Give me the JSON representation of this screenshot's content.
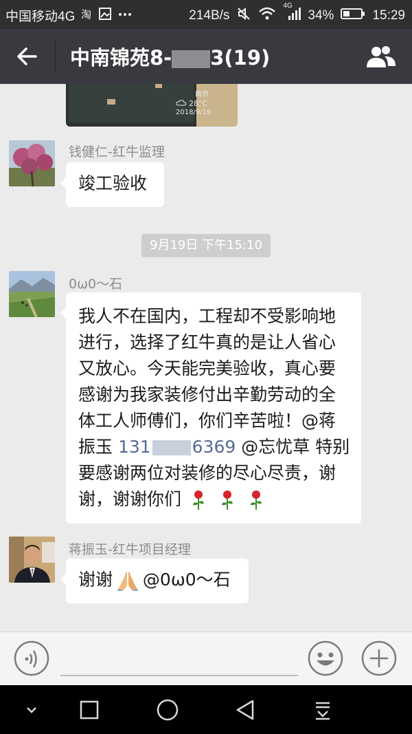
{
  "status_bar": {
    "carrier": "中国移动4G",
    "speed": "214B/s",
    "network_badge": "4G",
    "battery": "34%",
    "time": "15:29"
  },
  "header": {
    "title": "中南锦苑8-",
    "title_suffix": "3(19)"
  },
  "image_message": {
    "city": "南京",
    "temperature": "28°C",
    "date": "2018/9/19"
  },
  "messages": [
    {
      "sender": "钱健仁-红牛监理",
      "text": "竣工验收"
    },
    {
      "sender": "0ω0～石",
      "text_line1": "我人不在国内，工程却不受影响地",
      "text_line2": "进行，选择了红牛真的是让人省心",
      "text_line3": "又放心。今天能完美验收，真心要",
      "text_line4": "感谢为我家装修付出辛勤劳动的全",
      "text_line5": "体工人师傅们，你们辛苦啦！@蒋",
      "text_line6_prefix": "振玉 ",
      "phone_start": "131",
      "phone_end": "6369",
      "text_line6_suffix": " @忘忧草  特别",
      "text_line7": "要感谢两位对装修的尽心尽责，谢",
      "text_line8": "谢，谢谢你们"
    },
    {
      "sender": "蒋振玉-红牛项目经理",
      "text_prefix": "谢谢",
      "text_suffix": "@0ω0～石"
    }
  ],
  "time_divider": "9月19日 下午15:10",
  "colors": {
    "title_bar": "#393a3f",
    "status_bar": "#2f2f2f",
    "chat_bg": "#ebebeb",
    "bubble": "#ffffff",
    "link": "#576b95"
  },
  "icons": {
    "back": "back-arrow-icon",
    "members": "group-members-icon",
    "voice": "voice-input-icon",
    "emoji": "emoji-icon",
    "plus": "plus-icon",
    "rose": "rose-emoji-icon",
    "pray": "praying-hands-emoji-icon"
  }
}
